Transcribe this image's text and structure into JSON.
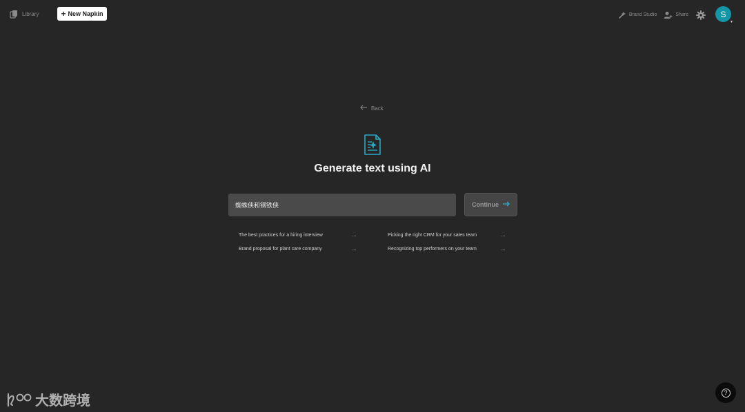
{
  "topbar": {
    "library_label": "Library",
    "new_napkin_label": "New Napkin",
    "brand_studio_label": "Brand Studio",
    "share_label": "Share",
    "avatar_initial": "S"
  },
  "main": {
    "back_label": "Back",
    "heading": "Generate text using AI",
    "prompt_value": "蜘蛛侠和钢铁侠",
    "continue_label": "Continue",
    "suggestions": [
      {
        "label": "The best practices for a hiring interview"
      },
      {
        "label": "Picking the right CRM for your sales team"
      },
      {
        "label": "Brand proposal for plant care company"
      },
      {
        "label": "Recognizing top performers on your team"
      }
    ]
  },
  "help": {
    "glyph": "?"
  },
  "watermark": {
    "text": "大数跨境"
  },
  "icons": {
    "library": "stacked-pages-icon",
    "brand_studio": "magic-wand-icon",
    "share": "person-plus-icon",
    "settings": "gear-icon",
    "back": "arrow-left-icon",
    "document": "document-ai-icon",
    "continue": "arrow-right-icon",
    "help": "question-icon"
  },
  "colors": {
    "background": "#262626",
    "accent": "#1596a8",
    "doc_icon": "#2aa9c8",
    "input_bg": "#4a4a4a"
  }
}
